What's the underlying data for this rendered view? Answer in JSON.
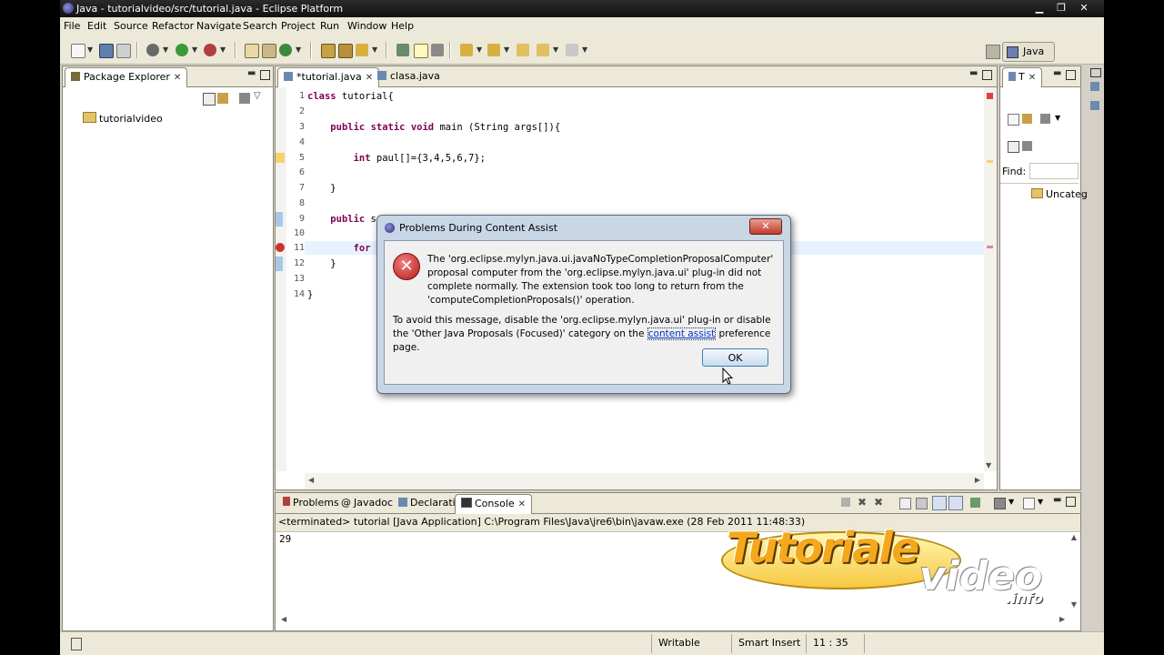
{
  "window": {
    "title": "Java - tutorialvideo/src/tutorial.java - Eclipse Platform"
  },
  "menu": [
    "File",
    "Edit",
    "Source",
    "Refactor",
    "Navigate",
    "Search",
    "Project",
    "Run",
    "Window",
    "Help"
  ],
  "perspective": {
    "label": "Java"
  },
  "package_explorer": {
    "tab": "Package Explorer",
    "items": [
      "tutorialvideo"
    ]
  },
  "editor": {
    "tabs": [
      "*tutorial.java",
      "clasa.java"
    ],
    "lines": [
      {
        "n": "1",
        "text": "class tutorial{"
      },
      {
        "n": "2",
        "text": ""
      },
      {
        "n": "3",
        "text": "    public static void main (String args[]){"
      },
      {
        "n": "4",
        "text": ""
      },
      {
        "n": "5",
        "text": "        int paul[]={3,4,5,6,7};"
      },
      {
        "n": "6",
        "text": ""
      },
      {
        "n": "7",
        "text": "    }"
      },
      {
        "n": "8",
        "text": ""
      },
      {
        "n": "9",
        "text": "    public s"
      },
      {
        "n": "10",
        "text": ""
      },
      {
        "n": "11",
        "text": "        for"
      },
      {
        "n": "12",
        "text": "    }"
      },
      {
        "n": "13",
        "text": ""
      },
      {
        "n": "14",
        "text": "}"
      }
    ]
  },
  "outline": {
    "tab": "T",
    "find_label": "Find:",
    "item": "Uncateg"
  },
  "console": {
    "tabs": [
      "Problems",
      "Javadoc",
      "Declaration",
      "Console"
    ],
    "header": "<terminated> tutorial [Java Application] C:\\Program Files\\Java\\jre6\\bin\\javaw.exe (28 Feb 2011 11:48:33)",
    "output": "29"
  },
  "dialog": {
    "title": "Problems During Content Assist",
    "message": "The 'org.eclipse.mylyn.java.ui.javaNoTypeCompletionProposalComputer' proposal computer from the 'org.eclipse.mylyn.java.ui' plug-in did not complete normally. The extension took too long to return from the 'computeCompletionProposals()' operation.",
    "advice_prefix": "To avoid this message, disable the 'org.eclipse.mylyn.java.ui' plug-in or disable the 'Other Java Proposals (Focused)' category on the ",
    "advice_link": "content assist",
    "advice_suffix": " preference page.",
    "ok_label": "OK"
  },
  "status": {
    "writable": "Writable",
    "insert_mode": "Smart Insert",
    "position": "11 : 35"
  },
  "watermark": {
    "word1": "Tutoriale",
    "word2": "video",
    "word3": ".info"
  }
}
